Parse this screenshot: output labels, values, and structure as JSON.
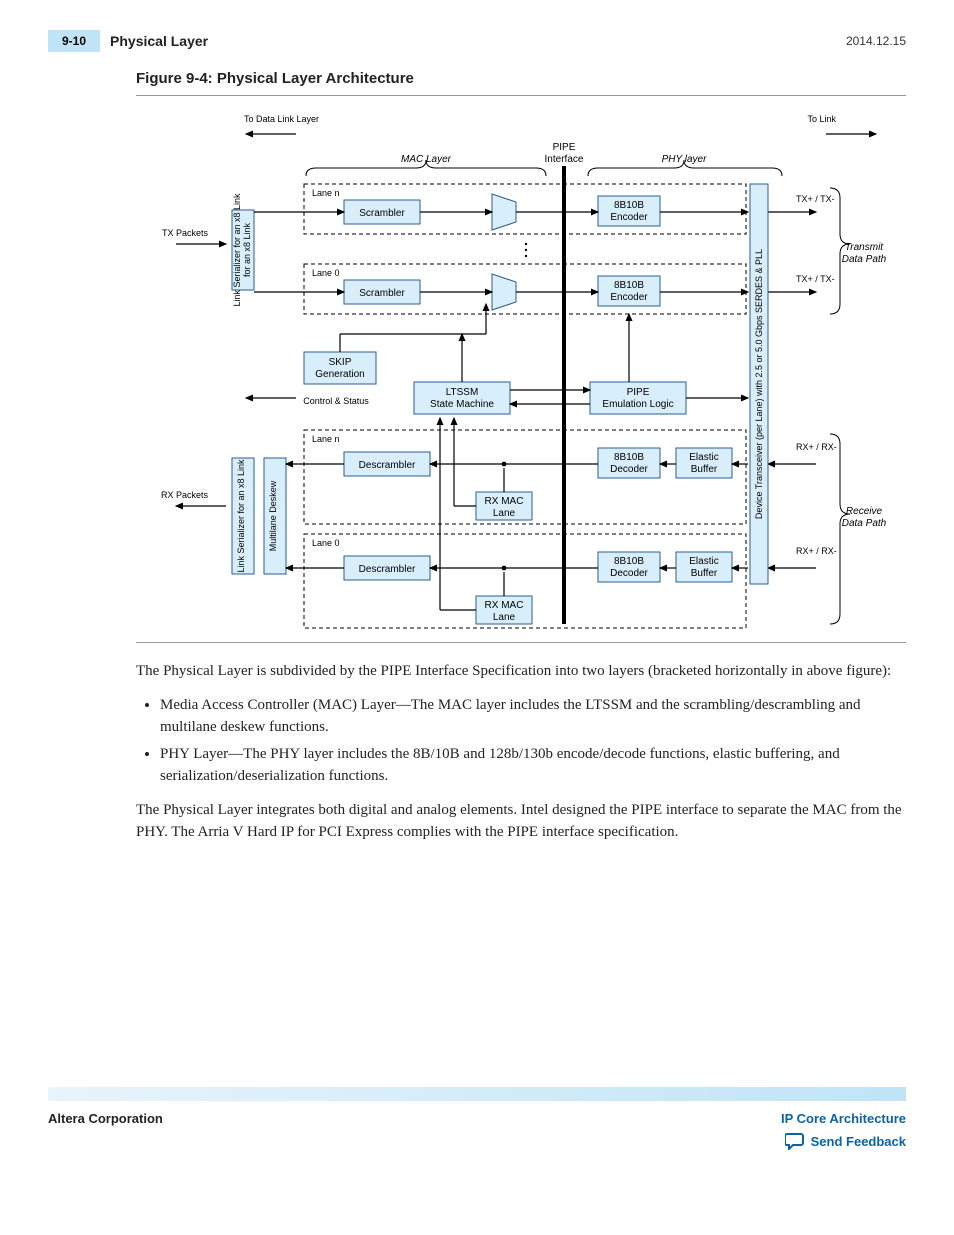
{
  "header": {
    "page_number": "9-10",
    "section": "Physical Layer",
    "date": "2014.12.15"
  },
  "figure": {
    "caption": "Figure 9-4: Physical Layer Architecture",
    "labels": {
      "to_data_link": "To Data Link Layer",
      "to_link": "To Link",
      "mac_layer": "MAC Layer",
      "phy_layer": "PHY layer",
      "pipe_interface_top": "PIPE",
      "pipe_interface_bot": "Interface",
      "tx_packets": "TX Packets",
      "rx_packets": "RX Packets",
      "link_ser_tx": "Link Serializer for an x8 Link",
      "link_ser_rx": "Link Serializer for an x8 Link",
      "multilane": "Multilane Deskew",
      "lane_n": "Lane n",
      "lane_0": "Lane 0",
      "scrambler": "Scrambler",
      "descrambler": "Descrambler",
      "skip_top": "SKIP",
      "skip_bot": "Generation",
      "ltssm_top": "LTSSM",
      "ltssm_bot": "State Machine",
      "pipe_emu_top": "PIPE",
      "pipe_emu_bot": "Emulation Logic",
      "ctrl_status": "Control & Status",
      "enc_top": "8B10B",
      "enc_bot": "Encoder",
      "dec_top": "8B10B",
      "dec_bot": "Decoder",
      "elastic_top": "Elastic",
      "elastic_bot": "Buffer",
      "rxmac_top": "RX MAC",
      "rxmac_bot": "Lane",
      "txp": "TX+ / TX-",
      "rxp": "RX+ / RX-",
      "tx_path_a": "Transmit",
      "tx_path_b": "Data Path",
      "rx_path_a": "Receive",
      "rx_path_b": "Data Path",
      "transceiver": "Device Transceiver (per Lane) with 2.5 or 5.0  Gbps SERDES & PLL"
    }
  },
  "body": {
    "intro": "The Physical Layer is subdivided by the PIPE Interface Specification into two layers (bracketed horizon­tally in above figure):",
    "bullets": [
      "Media Access Controller (MAC) Layer—The MAC layer includes the LTSSM and the scrambling/descrambling and multilane deskew functions.",
      "PHY Layer—The PHY layer includes the 8B/10B and 128b/130b encode/decode functions, elastic buffering, and serialization/deserialization functions."
    ],
    "para2": "The Physical Layer integrates both digital and analog elements. Intel designed the PIPE interface to separate the MAC from the PHY. The Arria V Hard IP for PCI Express complies with the PIPE interface specification."
  },
  "footer": {
    "left": "Altera Corporation",
    "right_link": "IP Core Architecture",
    "feedback": "Send Feedback"
  }
}
